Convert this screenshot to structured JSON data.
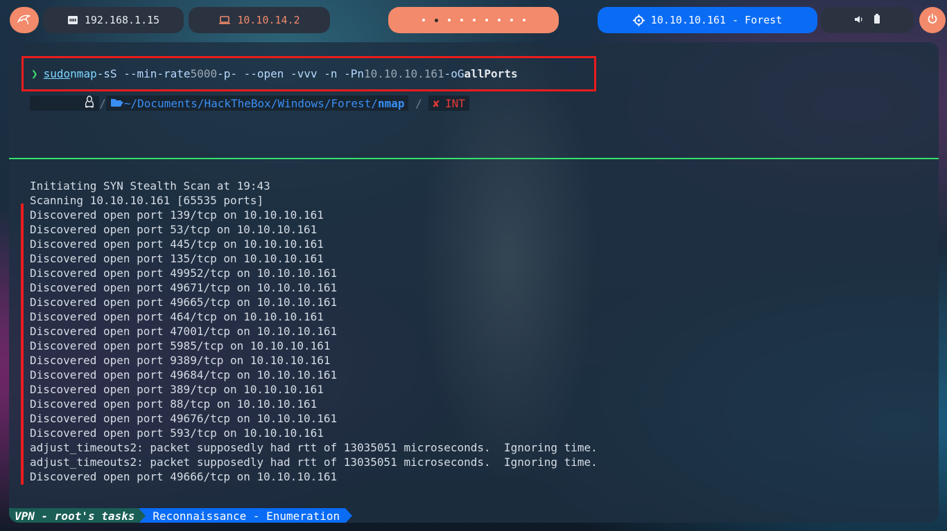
{
  "topbar": {
    "local_ip": "192.168.1.15",
    "vpn_ip": "10.10.14.2",
    "target": "10.10.10.161 - Forest",
    "workspace_count": 9,
    "active_workspace": 2,
    "icons": {
      "launcher": "kali-dragon-icon",
      "local": "ethernet-icon",
      "vpn": "laptop-icon",
      "target": "crosshair-icon",
      "volume": "volume-icon",
      "battery": "battery-icon",
      "power": "power-icon"
    },
    "colors": {
      "accent": "#f28a6b",
      "target": "#0a6cf5",
      "panel": "#2b3340"
    }
  },
  "terminal": {
    "command": {
      "prompt": "❯",
      "sudo": "sudo",
      "bin": "nmap",
      "args": "-sS --min-rate",
      "rate": "5000",
      "args2": "-p- --open -vvv -n -Pn",
      "ip": "10.10.10.161",
      "args3": "-oG",
      "out": "allPorts"
    },
    "path": {
      "home": "~/Documents/HackTheBox/Windows/Forest/",
      "last": "nmap",
      "status_mark": "✘",
      "status": "INT"
    },
    "output": [
      "Initiating SYN Stealth Scan at 19:43",
      "Scanning 10.10.10.161 [65535 ports]",
      "Discovered open port 139/tcp on 10.10.10.161",
      "Discovered open port 53/tcp on 10.10.10.161",
      "Discovered open port 445/tcp on 10.10.10.161",
      "Discovered open port 135/tcp on 10.10.10.161",
      "Discovered open port 49952/tcp on 10.10.10.161",
      "Discovered open port 49671/tcp on 10.10.10.161",
      "Discovered open port 49665/tcp on 10.10.10.161",
      "Discovered open port 464/tcp on 10.10.10.161",
      "Discovered open port 47001/tcp on 10.10.10.161",
      "Discovered open port 5985/tcp on 10.10.10.161",
      "Discovered open port 9389/tcp on 10.10.10.161",
      "Discovered open port 49684/tcp on 10.10.10.161",
      "Discovered open port 389/tcp on 10.10.10.161",
      "Discovered open port 88/tcp on 10.10.10.161",
      "Discovered open port 49676/tcp on 10.10.10.161",
      "Discovered open port 593/tcp on 10.10.10.161",
      "adjust_timeouts2: packet supposedly had rtt of 13035051 microseconds.  Ignoring time.",
      "adjust_timeouts2: packet supposedly had rtt of 13035051 microseconds.  Ignoring time.",
      "Discovered open port 49666/tcp on 10.10.10.161"
    ],
    "status_bar": {
      "left": "VPN - root's tasks",
      "right": "Reconnaissance - Enumeration"
    },
    "colors": {
      "highlight_box": "#ea1c1c",
      "divider": "#34e36b",
      "status_left": "#1a5e55",
      "status_right": "#0a6cf5"
    }
  }
}
